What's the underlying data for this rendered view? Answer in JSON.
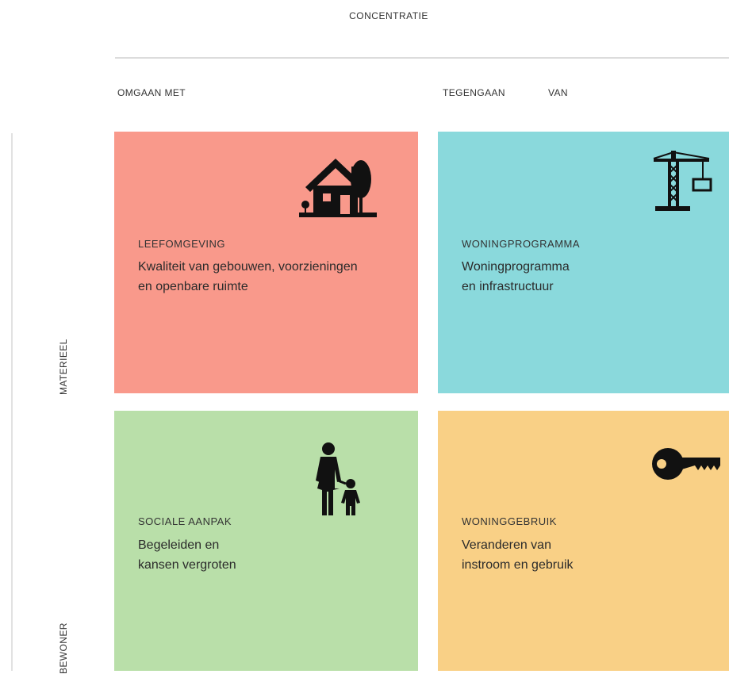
{
  "header": {
    "title": "CONCENTRATIE",
    "col_left": "OMGAAN MET",
    "col_right_a": "TEGENGAAN",
    "col_right_b": "VAN"
  },
  "rows": {
    "top": "MATERIEEL",
    "bottom": "BEWONER"
  },
  "tiles": [
    {
      "heading": "LEEFOMGEVING",
      "line1": "Kwaliteit van gebouwen, voorzieningen",
      "line2": "en openbare ruimte",
      "color": "#F9998B",
      "icon": "house-tree-icon"
    },
    {
      "heading": "WONINGPROGRAMMA",
      "line1": "Woningprogramma",
      "line2": "en infrastructuur",
      "color": "#8AD9DC",
      "icon": "construction-crane-icon"
    },
    {
      "heading": "SOCIALE AANPAK",
      "line1": "Begeleiden en",
      "line2": "kansen vergroten",
      "color": "#B9DFA9",
      "icon": "parent-child-icon"
    },
    {
      "heading": "WONINGGEBRUIK",
      "line1": "Veranderen van",
      "line2": "instroom en gebruik",
      "color": "#F9D086",
      "icon": "key-icon"
    }
  ]
}
